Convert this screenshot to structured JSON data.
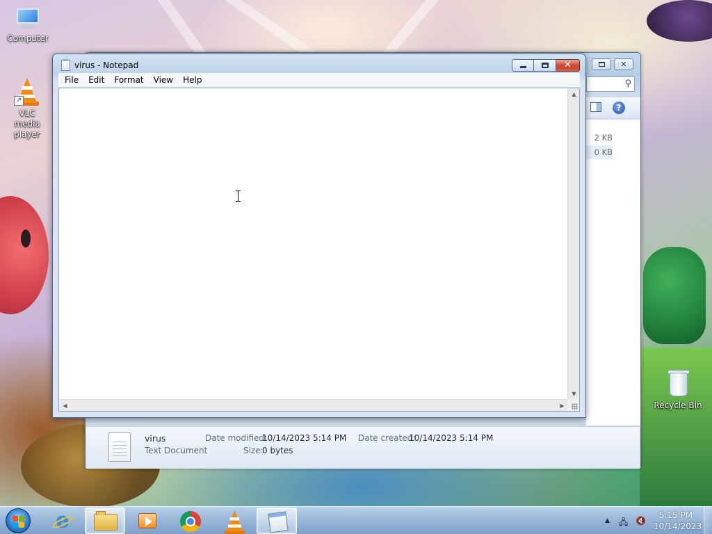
{
  "desktop": {
    "icons": [
      {
        "label": "Computer",
        "icon": "computer-icon"
      },
      {
        "label": "VLC media player",
        "icon": "vlc-cone-icon"
      },
      {
        "label": "Recycle Bin",
        "icon": "recycle-bin-icon"
      }
    ]
  },
  "explorer": {
    "sizes": [
      "2 KB",
      "0 KB"
    ],
    "details": {
      "file_name": "virus",
      "file_type": "Text Document",
      "date_modified_label": "Date modified:",
      "date_modified_value": "10/14/2023 5:14 PM",
      "date_created_label": "Date created:",
      "date_created_value": "10/14/2023 5:14 PM",
      "size_label": "Size:",
      "size_value": "0 bytes"
    }
  },
  "notepad": {
    "title": "virus - Notepad",
    "menu": [
      "File",
      "Edit",
      "Format",
      "View",
      "Help"
    ],
    "content": ""
  },
  "taskbar": {
    "items": [
      {
        "name": "internet-explorer",
        "icon": "internet-explorer-icon",
        "active": false
      },
      {
        "name": "windows-explorer",
        "icon": "folder-icon",
        "active": true
      },
      {
        "name": "windows-media-player",
        "icon": "media-player-icon",
        "active": false
      },
      {
        "name": "google-chrome",
        "icon": "chrome-icon",
        "active": false
      },
      {
        "name": "vlc-media-player",
        "icon": "vlc-cone-icon",
        "active": false
      },
      {
        "name": "notepad",
        "icon": "notepad-icon",
        "active": true
      }
    ],
    "clock": {
      "time": "5:15 PM",
      "date": "10/14/2023"
    }
  },
  "colors": {
    "close_button": "#c64530",
    "taskbar": "#96b4d7",
    "window_frame": "#bfd4eb"
  }
}
